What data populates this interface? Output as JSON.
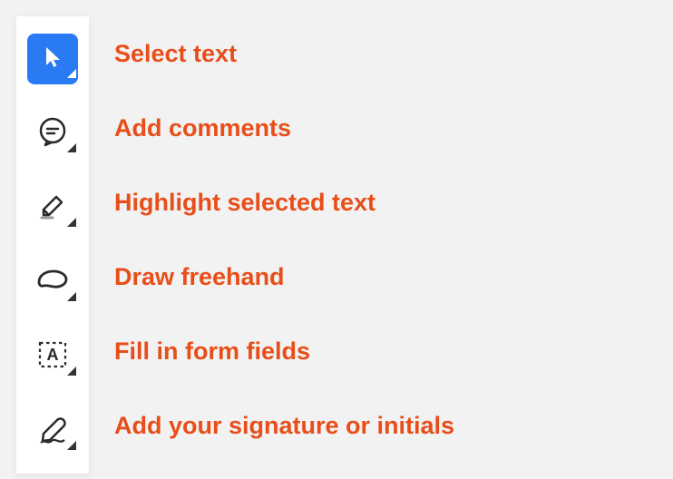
{
  "tools": [
    {
      "id": "select-text",
      "label": "Select text",
      "icon": "cursor-icon",
      "active": true
    },
    {
      "id": "add-comments",
      "label": "Add comments",
      "icon": "comment-icon",
      "active": false
    },
    {
      "id": "highlight",
      "label": "Highlight selected text",
      "icon": "highlighter-icon",
      "active": false
    },
    {
      "id": "draw-freehand",
      "label": "Draw freehand",
      "icon": "lasso-icon",
      "active": false
    },
    {
      "id": "fill-form",
      "label": "Fill in form fields",
      "icon": "text-box-icon",
      "active": false
    },
    {
      "id": "signature",
      "label": "Add your signature or initials",
      "icon": "signature-icon",
      "active": false
    }
  ]
}
